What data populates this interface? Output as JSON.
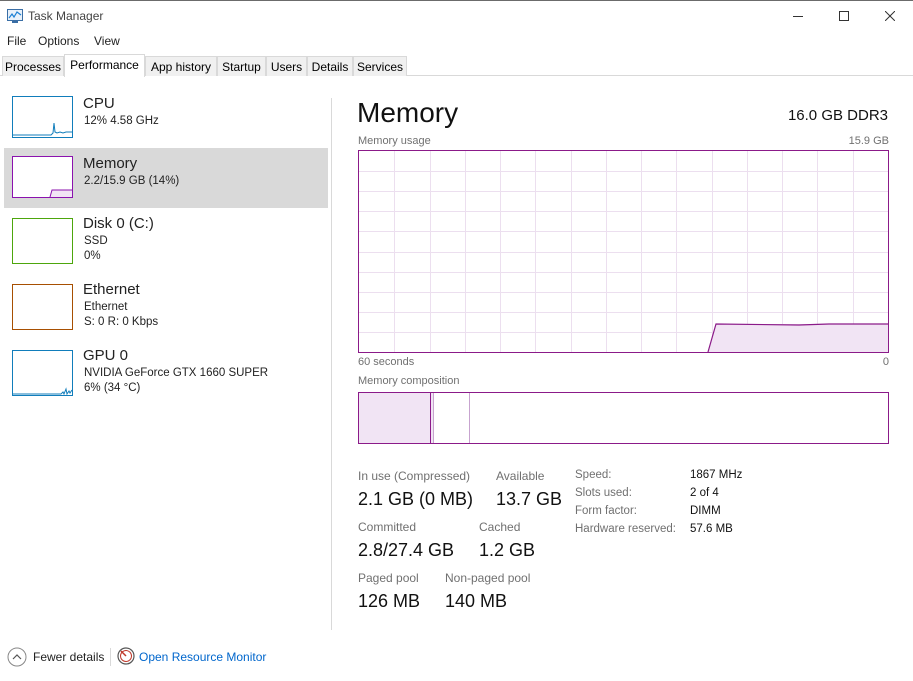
{
  "window": {
    "title": "Task Manager"
  },
  "menu": [
    "File",
    "Options",
    "View"
  ],
  "tabs": [
    "Processes",
    "Performance",
    "App history",
    "Startup",
    "Users",
    "Details",
    "Services"
  ],
  "active_tab": "Performance",
  "sidebar": {
    "items": [
      {
        "name": "CPU",
        "lines": [
          "12%  4.58 GHz"
        ],
        "color": "#117dbb"
      },
      {
        "name": "Memory",
        "lines": [
          "2.2/15.9 GB (14%)"
        ],
        "color": "#8b12ae"
      },
      {
        "name": "Disk 0 (C:)",
        "lines": [
          "SSD",
          "0%"
        ],
        "color": "#4da60c"
      },
      {
        "name": "Ethernet",
        "lines": [
          "Ethernet",
          "S: 0  R: 0 Kbps"
        ],
        "color": "#a74f01"
      },
      {
        "name": "GPU 0",
        "lines": [
          "NVIDIA GeForce GTX 1660 SUPER",
          "6%  (34 °C)"
        ],
        "color": "#117dbb"
      }
    ]
  },
  "main": {
    "title": "Memory",
    "spec": "16.0 GB DDR3",
    "usage_label": "Memory usage",
    "usage_max": "15.9 GB",
    "time_left": "60 seconds",
    "time_right": "0",
    "composition_label": "Memory composition",
    "usage_fraction": 0.14,
    "stats": [
      {
        "label": "In use (Compressed)",
        "value": "2.1 GB (0 MB)"
      },
      {
        "label": "Available",
        "value": "13.7 GB"
      },
      {
        "label": "Committed",
        "value": "2.8/27.4 GB"
      },
      {
        "label": "Cached",
        "value": "1.2 GB"
      },
      {
        "label": "Paged pool",
        "value": "126 MB"
      },
      {
        "label": "Non-paged pool",
        "value": "140 MB"
      }
    ],
    "details": [
      {
        "label": "Speed:",
        "value": "1867 MHz"
      },
      {
        "label": "Slots used:",
        "value": "2 of 4"
      },
      {
        "label": "Form factor:",
        "value": "DIMM"
      },
      {
        "label": "Hardware reserved:",
        "value": "57.6 MB"
      }
    ]
  },
  "footer": {
    "fewer_details": "Fewer details",
    "open_resource_monitor": "Open Resource Monitor"
  },
  "colors": {
    "memory_accent": "#8b1a89",
    "link": "#0066cc",
    "selected_bg": "#d9d9d9"
  }
}
